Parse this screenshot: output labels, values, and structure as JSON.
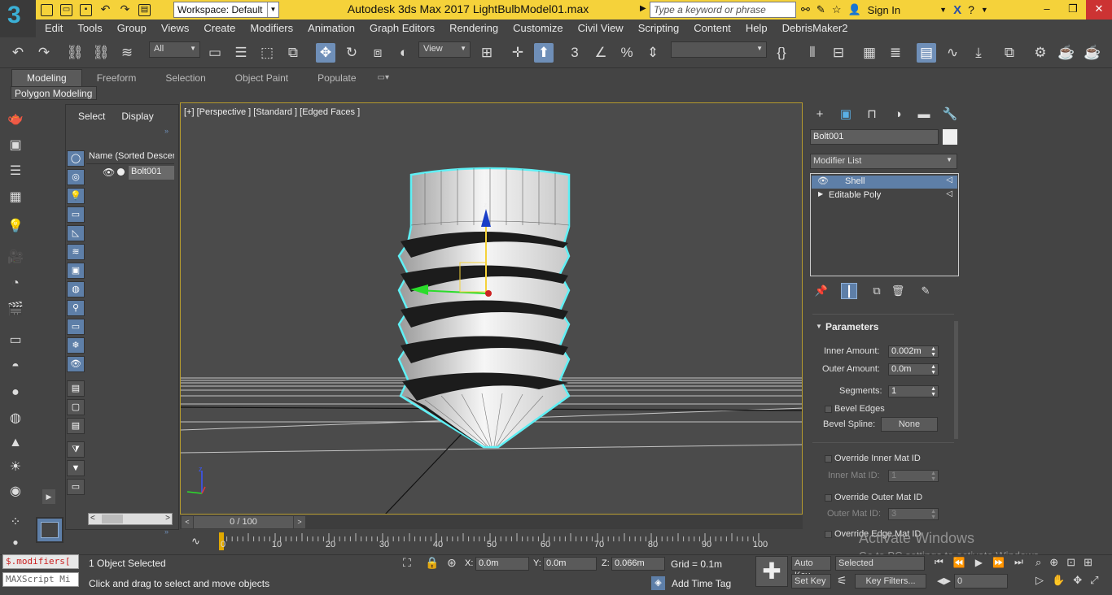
{
  "title_bar": {
    "logo": "3",
    "workspace": "Workspace: Default",
    "app_title": "Autodesk 3ds Max 2017     LightBulbModel01.max",
    "search_placeholder": "Type a keyword or phrase",
    "sign_in": "Sign In"
  },
  "menu": [
    "Edit",
    "Tools",
    "Group",
    "Views",
    "Create",
    "Modifiers",
    "Animation",
    "Graph Editors",
    "Rendering",
    "Customize",
    "Civil View",
    "Scripting",
    "Content",
    "Help",
    "DebrisMaker2"
  ],
  "toolbar": {
    "selection_filter": "All",
    "reference_coord": "View"
  },
  "ribbon": {
    "tabs": [
      "Modeling",
      "Freeform",
      "Selection",
      "Object Paint",
      "Populate"
    ],
    "active_panel": "Polygon Modeling"
  },
  "scene_explorer": {
    "tabs": [
      "Select",
      "Display"
    ],
    "column_header": "Name (Sorted Descen",
    "objects": [
      "Bolt001"
    ]
  },
  "viewport": {
    "label": "[+] [Perspective ] [Standard ] [Edged Faces ]",
    "gizmo_axis": "z",
    "corner_axis_z": "z"
  },
  "time_slider": {
    "value": "0 / 100",
    "prev": "<",
    "next": ">"
  },
  "track_bar": {
    "ticks": [
      "0",
      "10",
      "20",
      "30",
      "40",
      "50",
      "60",
      "70",
      "80",
      "90",
      "100"
    ]
  },
  "command_panel": {
    "object_name": "Bolt001",
    "modifier_list": "Modifier List",
    "stack": [
      {
        "name": "Shell",
        "selected": true
      },
      {
        "name": "Editable Poly",
        "selected": false
      }
    ],
    "rollout_title": "Parameters",
    "params": {
      "inner_amount_label": "Inner Amount:",
      "inner_amount": "0.002m",
      "outer_amount_label": "Outer Amount:",
      "outer_amount": "0.0m",
      "segments_label": "Segments:",
      "segments": "1",
      "bevel_edges": "Bevel Edges",
      "bevel_spline_label": "Bevel Spline:",
      "bevel_spline": "None",
      "override_inner": "Override Inner Mat ID",
      "inner_mat_label": "Inner Mat ID:",
      "inner_mat": "1",
      "override_outer": "Override Outer Mat ID",
      "outer_mat_label": "Outer Mat ID:",
      "outer_mat": "3",
      "override_edge": "Override Edge Mat ID"
    },
    "watermark_title": "Activate Windows",
    "watermark_sub": "Go to PC settings to activate Windows."
  },
  "status": {
    "maxscript_1": "$.modifiers[",
    "maxscript_2": "MAXScript Mi",
    "selected": "1 Object Selected",
    "hint": "Click and drag to select and move objects",
    "x_label": "X:",
    "x": "0.0m",
    "y_label": "Y:",
    "y": "0.0m",
    "z_label": "Z:",
    "z": "0.066m",
    "grid": "Grid = 0.1m",
    "add_time_tag": "Add Time Tag",
    "auto_key": "Auto Key",
    "set_key": "Set Key",
    "selected_dropdown": "Selected",
    "key_filters": "Key Filters...",
    "frame": "0"
  },
  "colors": {
    "title_bar": "#f5d23a",
    "accent_blue": "#5e7fa8",
    "selection_outline": "#5ff0f5",
    "viewport_border": "#b59a2e"
  }
}
